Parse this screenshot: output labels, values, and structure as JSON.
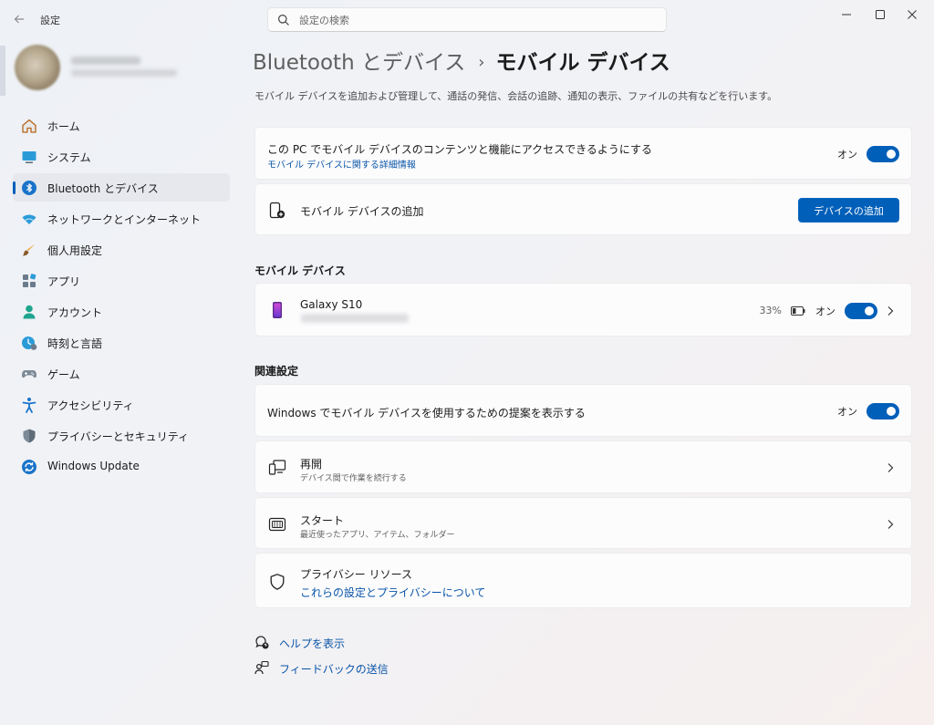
{
  "window": {
    "title": "設定",
    "back_icon": "back-arrow-icon"
  },
  "search": {
    "placeholder": "設定の検索"
  },
  "sidebar": {
    "items": [
      {
        "label": "ホーム",
        "icon": "home-icon"
      },
      {
        "label": "システム",
        "icon": "system-icon"
      },
      {
        "label": "Bluetooth とデバイス",
        "icon": "bluetooth-icon",
        "selected": true
      },
      {
        "label": "ネットワークとインターネット",
        "icon": "wifi-icon"
      },
      {
        "label": "個人用設定",
        "icon": "brush-icon"
      },
      {
        "label": "アプリ",
        "icon": "apps-icon"
      },
      {
        "label": "アカウント",
        "icon": "account-icon"
      },
      {
        "label": "時刻と言語",
        "icon": "time-language-icon"
      },
      {
        "label": "ゲーム",
        "icon": "gamepad-icon"
      },
      {
        "label": "アクセシビリティ",
        "icon": "accessibility-icon"
      },
      {
        "label": "プライバシーとセキュリティ",
        "icon": "shield-icon"
      },
      {
        "label": "Windows Update",
        "icon": "update-icon"
      }
    ]
  },
  "breadcrumb": {
    "parent": "Bluetooth とデバイス",
    "separator": "›",
    "current": "モバイル デバイス"
  },
  "page": {
    "description": "モバイル デバイスを追加および管理して、通話の発信、会話の追跡、通知の表示、ファイルの共有などを行います。"
  },
  "access_card": {
    "title": "この PC でモバイル デバイスのコンテンツと機能にアクセスできるようにする",
    "link": "モバイル デバイスに関する詳細情報",
    "toggle_label": "オン",
    "toggle_on": true
  },
  "add_card": {
    "title": "モバイル デバイスの追加",
    "button": "デバイスの追加"
  },
  "devices_section": {
    "title": "モバイル デバイス",
    "device": {
      "name": "Galaxy S10",
      "battery": "33%",
      "toggle_label": "オン",
      "toggle_on": true
    }
  },
  "related": {
    "title": "関連設定",
    "suggestion": {
      "title": "Windows でモバイル デバイスを使用するための提案を表示する",
      "toggle_label": "オン",
      "toggle_on": true
    },
    "resume": {
      "title": "再開",
      "subtitle": "デバイス間で作業を続行する"
    },
    "start": {
      "title": "スタート",
      "subtitle": "最近使ったアプリ、アイテム、フォルダー"
    },
    "privacy": {
      "title": "プライバシー リソース",
      "link": "これらの設定とプライバシーについて"
    }
  },
  "footer": {
    "help": "ヘルプを表示",
    "feedback": "フィードバックの送信"
  },
  "colors": {
    "accent": "#005fb8",
    "link": "#0a55a8"
  }
}
